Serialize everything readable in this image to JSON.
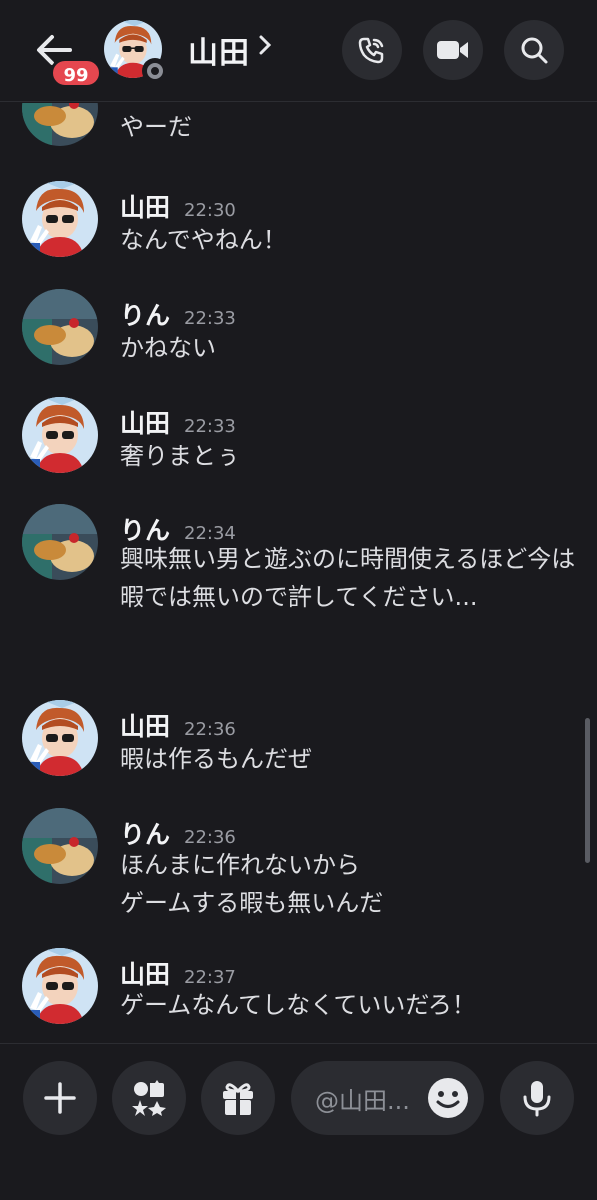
{
  "header": {
    "unread_badge": "99",
    "name": "山田",
    "chevron": "›",
    "icons": [
      "back-arrow-icon",
      "call-icon",
      "video-icon",
      "search-icon"
    ]
  },
  "messages": [
    {
      "name": "",
      "time": "",
      "text": "やーだ",
      "avatar": "rin"
    },
    {
      "name": "山田",
      "time": "22:30",
      "text": "なんでやねん！",
      "avatar": "yamada"
    },
    {
      "name": "りん",
      "time": "22:33",
      "text": "かねない",
      "avatar": "rin"
    },
    {
      "name": "山田",
      "time": "22:33",
      "text": "奢りまとぅ",
      "avatar": "yamada"
    },
    {
      "name": "りん",
      "time": "22:34",
      "text": "興味無い男と遊ぶのに時間使えるほど今は暇では無いので許してください...",
      "avatar": "rin"
    },
    {
      "name": "山田",
      "time": "22:36",
      "text": "暇は作るもんだぜ",
      "avatar": "yamada"
    },
    {
      "name": "りん",
      "time": "22:36",
      "text": "ほんまに作れないから\nゲームする暇も無いんだ",
      "avatar": "rin"
    },
    {
      "name": "山田",
      "time": "22:37",
      "text": "ゲームなんてしなくていいだろ！",
      "avatar": "yamada"
    }
  ],
  "composer": {
    "placeholder": "@山田...",
    "icons": [
      "plus-icon",
      "apps-icon",
      "gift-icon",
      "emoji-icon",
      "microphone-icon"
    ]
  },
  "colors": {
    "background": "#1a1a1e",
    "badge": "#e5474f",
    "button_bg": "#2b2c31"
  }
}
